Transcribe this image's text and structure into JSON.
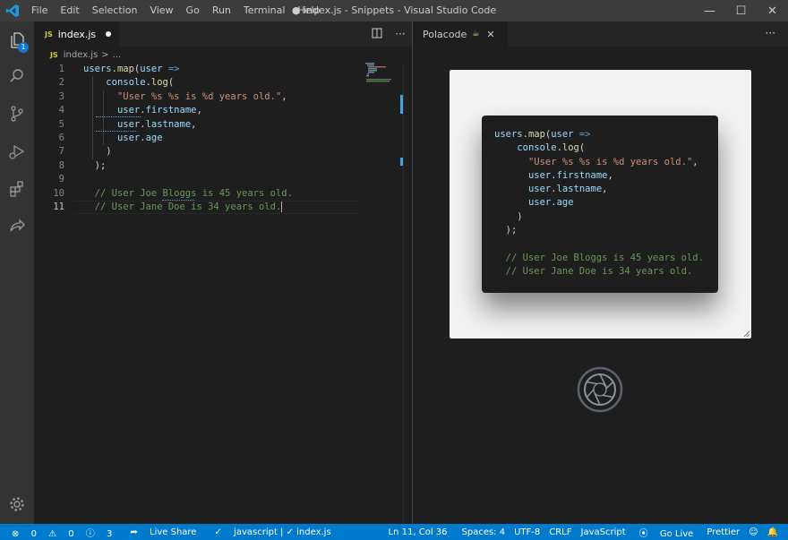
{
  "menu": [
    "File",
    "Edit",
    "Selection",
    "View",
    "Go",
    "Run",
    "Terminal",
    "Help"
  ],
  "window_title": "● index.js - Snippets - Visual Studio Code",
  "activity_badge": "1",
  "editor_tab": {
    "icon": "JS",
    "label": "index.js"
  },
  "breadcrumb": {
    "icon": "JS",
    "file": "index.js",
    "sep": ">",
    "rest": "..."
  },
  "code_lines": [
    {
      "n": "1",
      "html": "<span class='k-var'>users</span>.<span class='k-fn'>map</span>(<span class='k-var'>user</span> <span class='k-kw'>=&gt;</span>"
    },
    {
      "n": "2",
      "html": "    <span class='k-var'>console</span>.<span class='k-fn'>log</span>("
    },
    {
      "n": "3",
      "html": "      <span class='k-str'>\"User %s %s is %d years old.\"</span>,"
    },
    {
      "n": "4",
      "html": "      <span class='k-var'>user</span>.<span class='k-var'>firstname</span>,"
    },
    {
      "n": "5",
      "html": "      <span class='k-var'>user</span>.<span class='k-var'>lastname</span>,"
    },
    {
      "n": "6",
      "html": "      <span class='k-var'>user</span>.<span class='k-var'>age</span>"
    },
    {
      "n": "7",
      "html": "    )"
    },
    {
      "n": "8",
      "html": "  );"
    },
    {
      "n": "9",
      "html": ""
    },
    {
      "n": "10",
      "html": "  <span class='k-cm'>// User Joe Bloggs is 45 years old.</span>"
    },
    {
      "n": "11",
      "html": "  <span class='k-cm'>// User Jane Doe is 34 years old.</span>"
    }
  ],
  "panel_tab": {
    "label": "Polacode"
  },
  "snippet_lines": [
    "<span class='k-var'>users</span>.<span class='k-fn'>map</span>(<span class='k-var'>user</span> <span class='k-kw'>=&gt;</span>",
    "    <span class='k-var'>console</span>.<span class='k-fn'>log</span>(",
    "      <span class='k-str'>\"User %s %s is %d years old.\"</span>,",
    "      <span class='k-var'>user</span>.<span class='k-var'>firstname</span>,",
    "      <span class='k-var'>user</span>.<span class='k-var'>lastname</span>,",
    "      <span class='k-var'>user</span>.<span class='k-var'>age</span>",
    "    )",
    "  );",
    "",
    "  <span class='k-cm'>// User Joe Bloggs is 45 years old.</span>",
    "  <span class='k-cm'>// User Jane Doe is 34 years old.</span>"
  ],
  "status": {
    "errors": "0",
    "warnings": "0",
    "infos": "3",
    "live_share": "Live Share",
    "lang_check": "javascript | ✓ index.js",
    "position": "Ln 11, Col 36",
    "spaces": "Spaces: 4",
    "encoding": "UTF-8",
    "eol": "CRLF",
    "language": "JavaScript",
    "go_live": "Go Live",
    "prettier": "Prettier"
  },
  "colors": {
    "accent": "#007acc",
    "string": "#ce9178",
    "comment": "#6a9955",
    "variable": "#9cdcfe",
    "function": "#dcdcaa"
  }
}
